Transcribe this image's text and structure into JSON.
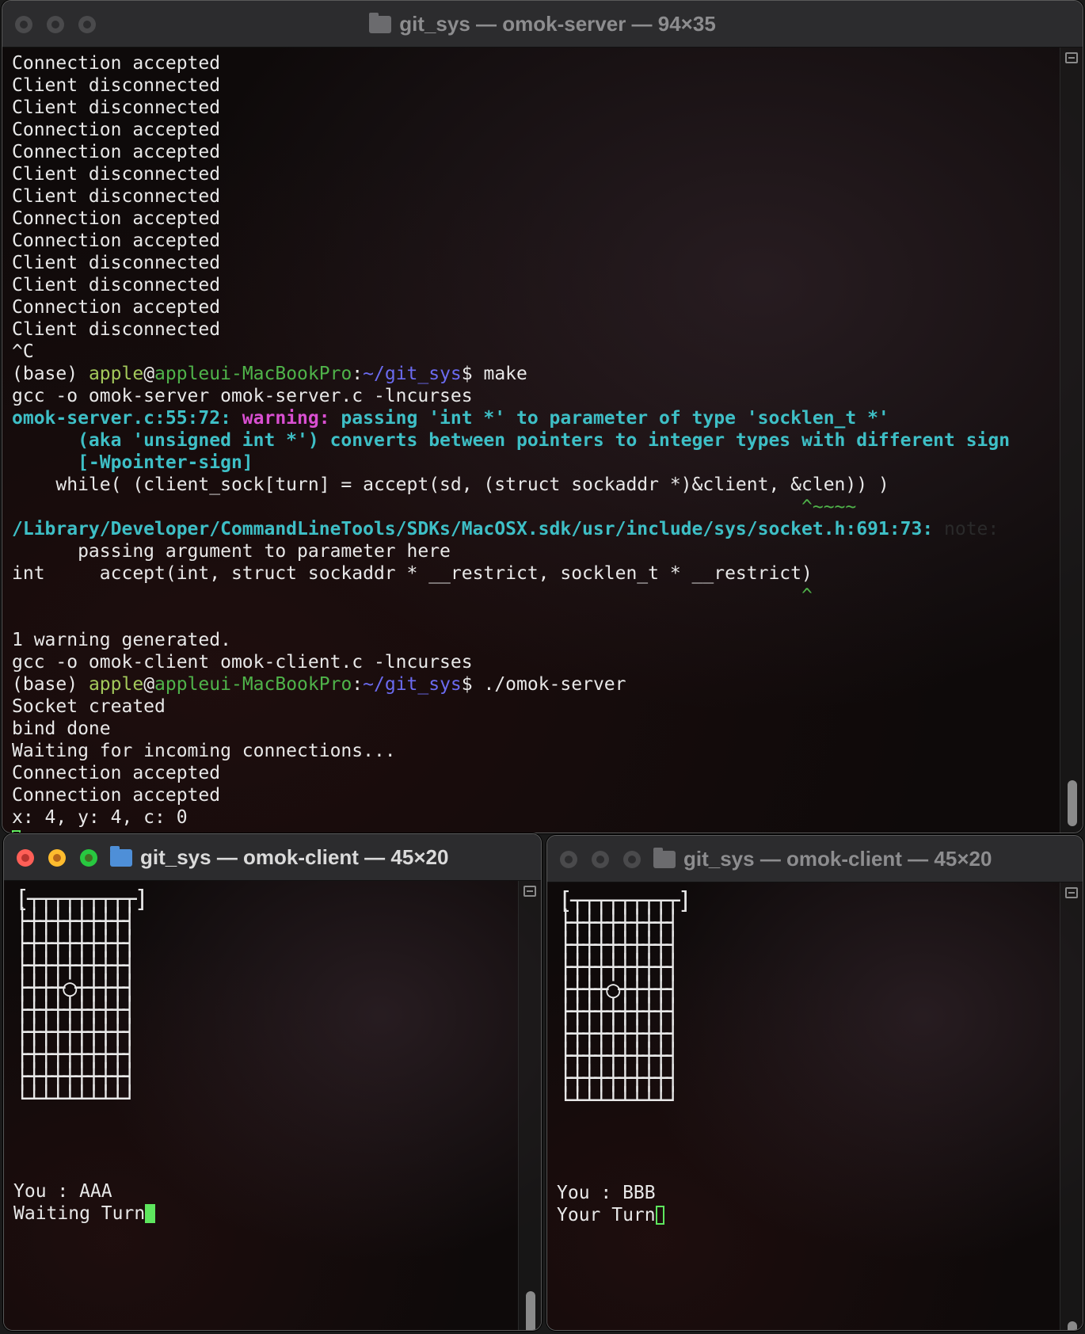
{
  "server_window": {
    "title": "git_sys — omok-server — 94×35",
    "lines": [
      {
        "segs": [
          {
            "t": "Connection accepted",
            "c": ""
          }
        ]
      },
      {
        "segs": [
          {
            "t": "Client disconnected",
            "c": ""
          }
        ]
      },
      {
        "segs": [
          {
            "t": "Client disconnected",
            "c": ""
          }
        ],
        "bracket": true
      },
      {
        "segs": [
          {
            "t": "Connection accepted",
            "c": ""
          }
        ]
      },
      {
        "segs": [
          {
            "t": "Connection accepted",
            "c": ""
          }
        ]
      },
      {
        "segs": [
          {
            "t": "Client disconnected",
            "c": ""
          }
        ]
      },
      {
        "segs": [
          {
            "t": "Client disconnected",
            "c": ""
          }
        ]
      },
      {
        "segs": [
          {
            "t": "Connection accepted",
            "c": ""
          }
        ]
      },
      {
        "segs": [
          {
            "t": "Connection accepted",
            "c": ""
          }
        ]
      },
      {
        "segs": [
          {
            "t": "Client disconnected",
            "c": ""
          }
        ]
      },
      {
        "segs": [
          {
            "t": "Client disconnected",
            "c": ""
          }
        ]
      },
      {
        "segs": [
          {
            "t": "Connection accepted",
            "c": ""
          }
        ]
      },
      {
        "segs": [
          {
            "t": "Client disconnected",
            "c": ""
          }
        ]
      },
      {
        "segs": [
          {
            "t": "^C",
            "c": ""
          }
        ]
      },
      {
        "segs": [
          {
            "t": "(base) ",
            "c": ""
          },
          {
            "t": "apple",
            "c": "c-green"
          },
          {
            "t": "@",
            "c": ""
          },
          {
            "t": "appleui-MacBookPro",
            "c": "c-green2"
          },
          {
            "t": ":",
            "c": ""
          },
          {
            "t": "~/git_sys",
            "c": "c-blue"
          },
          {
            "t": "$ make",
            "c": ""
          }
        ],
        "bracket": true
      },
      {
        "segs": [
          {
            "t": "gcc -o omok-server omok-server.c -lncurses",
            "c": ""
          }
        ]
      },
      {
        "segs": [
          {
            "t": "omok-server.c:55:72: ",
            "c": "c-cyan"
          },
          {
            "t": "warning: ",
            "c": "c-mag"
          },
          {
            "t": "passing 'int *' to parameter of type 'socklen_t *'",
            "c": "c-cyan"
          }
        ]
      },
      {
        "segs": [
          {
            "t": "      (aka 'unsigned int *') converts between pointers to integer types with different sign",
            "c": "c-cyan"
          }
        ]
      },
      {
        "segs": [
          {
            "t": "      [-Wpointer-sign]",
            "c": "c-cyan"
          }
        ]
      },
      {
        "segs": [
          {
            "t": "    while( (client_sock[turn] = accept(sd, (struct sockaddr *)&client, &clen)) )",
            "c": ""
          }
        ]
      },
      {
        "segs": [
          {
            "t": "                                                                        ^~~~~",
            "c": "c-green2"
          }
        ]
      },
      {
        "segs": [
          {
            "t": "/Library/Developer/CommandLineTools/SDKs/MacOSX.sdk/usr/include/sys/socket.h:691:73: ",
            "c": "c-cyan"
          },
          {
            "t": "note:",
            "c": "c-gray"
          }
        ]
      },
      {
        "segs": [
          {
            "t": "      passing argument to parameter here",
            "c": ""
          }
        ]
      },
      {
        "segs": [
          {
            "t": "int     accept(int, struct sockaddr * __restrict, socklen_t * __restrict)",
            "c": ""
          }
        ]
      },
      {
        "segs": [
          {
            "t": "                                                                        ^",
            "c": "c-green2"
          }
        ]
      },
      {
        "segs": [
          {
            "t": "",
            "c": ""
          }
        ]
      },
      {
        "segs": [
          {
            "t": "1 warning generated.",
            "c": ""
          }
        ]
      },
      {
        "segs": [
          {
            "t": "gcc -o omok-client omok-client.c -lncurses",
            "c": ""
          }
        ]
      },
      {
        "segs": [
          {
            "t": "(base) ",
            "c": ""
          },
          {
            "t": "apple",
            "c": "c-green"
          },
          {
            "t": "@",
            "c": ""
          },
          {
            "t": "appleui-MacBookPro",
            "c": "c-green2"
          },
          {
            "t": ":",
            "c": ""
          },
          {
            "t": "~/git_sys",
            "c": "c-blue"
          },
          {
            "t": "$ ./omok-server",
            "c": ""
          }
        ],
        "bracket": true
      },
      {
        "segs": [
          {
            "t": "Socket created",
            "c": ""
          }
        ]
      },
      {
        "segs": [
          {
            "t": "bind done",
            "c": ""
          }
        ]
      },
      {
        "segs": [
          {
            "t": "Waiting for incoming connections...",
            "c": ""
          }
        ]
      },
      {
        "segs": [
          {
            "t": "Connection accepted",
            "c": ""
          }
        ]
      },
      {
        "segs": [
          {
            "t": "Connection accepted",
            "c": ""
          }
        ]
      },
      {
        "segs": [
          {
            "t": "x: 4, y: 4, c: 0",
            "c": ""
          }
        ]
      }
    ]
  },
  "client_left": {
    "title": "git_sys — omok-client — 45×20",
    "board": [
      "[┬┬┬┬┬┬┬┬┬]",
      "├┼┼┼┼┼┼┼┼┤",
      "├┼┼┼┼┼┼┼┼┤",
      "├┼┼┼┼┼┼┼┼┤",
      "├┼┼┼○┼┼┼┼┤",
      "├┼┼┼┼┼┼┼┼┤",
      "├┼┼┼┼┼┼┼┼┤",
      "├┼┼┼┼┼┼┼┼┤",
      "├┼┼┼┼┼┼┼┼┤",
      "└┴┴┴┴┴┴┴┴┘"
    ],
    "you_line": "You : AAA",
    "status_line": "Waiting Turn"
  },
  "client_right": {
    "title": "git_sys — omok-client — 45×20",
    "board": [
      "[┬┬┬┬┬┬┬┬┬]",
      "├┼┼┼┼┼┼┼┼┤",
      "├┼┼┼┼┼┼┼┼┤",
      "├┼┼┼┼┼┼┼┼┤",
      "├┼┼┼○┼┼┼┼┤",
      "├┼┼┼┼┼┼┼┼┤",
      "├┼┼┼┼┼┼┼┼┤",
      "├┼┼┼┼┼┼┼┼┤",
      "├┼┼┼┼┼┼┼┼┤",
      "└┴┴┴┴┴┴┴┴┘"
    ],
    "you_line": "You : BBB",
    "status_line": "Your Turn"
  }
}
